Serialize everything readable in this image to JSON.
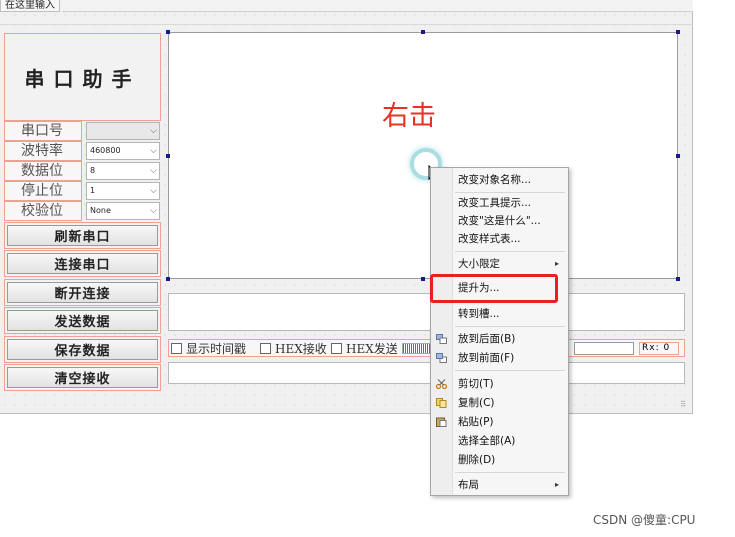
{
  "top_tab": {
    "label": "在这里输入"
  },
  "panel": {
    "title": "串口助手",
    "fields": [
      {
        "label": "串口号",
        "value": ""
      },
      {
        "label": "波特率",
        "value": "460800"
      },
      {
        "label": "数据位",
        "value": "8"
      },
      {
        "label": "停止位",
        "value": "1"
      },
      {
        "label": "校验位",
        "value": "None"
      }
    ],
    "buttons": [
      "刷新串口",
      "连接串口",
      "断开连接",
      "发送数据",
      "保存数据",
      "清空接收"
    ]
  },
  "options": {
    "show_timestamp": "显示时间戳",
    "hex_receive": "HEX接收",
    "hex_send": "HEX发送",
    "rx_counter": "Rx: 0"
  },
  "annotation": {
    "text": "右击",
    "color": "#e53424"
  },
  "context_menu": {
    "items": [
      {
        "label": "改变对象名称...",
        "icon": ""
      },
      {
        "label": "改变工具提示...",
        "icon": ""
      },
      {
        "label": "改变\"这是什么\"...",
        "icon": ""
      },
      {
        "label": "改变样式表...",
        "icon": ""
      },
      {
        "label": "大小限定",
        "icon": "",
        "submenu": true
      },
      {
        "label": "提升为...",
        "icon": "",
        "highlighted": true
      },
      {
        "label": "转到槽...",
        "icon": ""
      },
      {
        "label": "放到后面(B)",
        "icon": "send-back-icon"
      },
      {
        "label": "放到前面(F)",
        "icon": "bring-front-icon"
      },
      {
        "label": "剪切(T)",
        "icon": "scissors-icon"
      },
      {
        "label": "复制(C)",
        "icon": "copy-icon"
      },
      {
        "label": "粘贴(P)",
        "icon": "paste-icon"
      },
      {
        "label": "选择全部(A)",
        "icon": ""
      },
      {
        "label": "删除(D)",
        "icon": ""
      },
      {
        "label": "布局",
        "icon": "",
        "submenu": true
      }
    ],
    "submenu_arrow": "▸"
  },
  "watermark": "CSDN @傻童:CPU",
  "colors": {
    "highlight": "#e82020",
    "layout_border": "#f0a090",
    "selection_handle": "#1a1a8c"
  }
}
